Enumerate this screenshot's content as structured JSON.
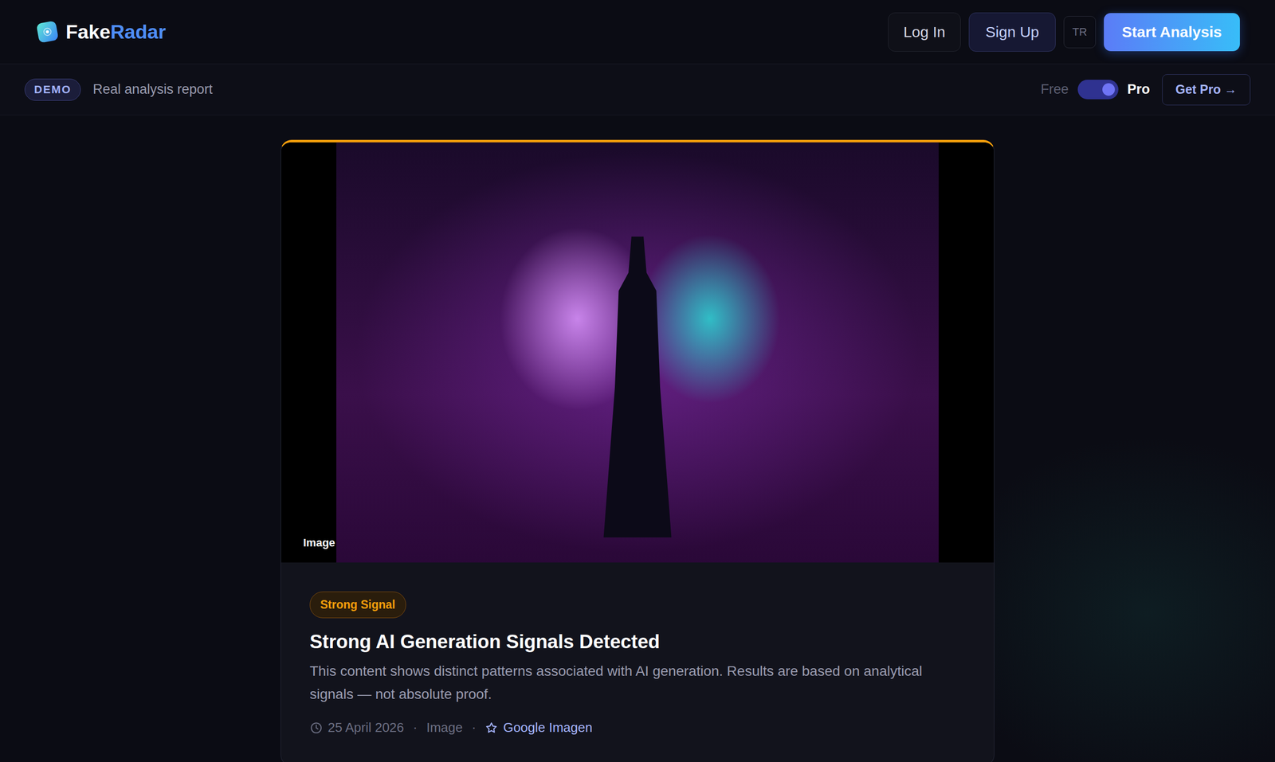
{
  "brand": {
    "name_first": "Fake",
    "name_second": "Radar"
  },
  "nav": {
    "login": "Log In",
    "signup": "Sign Up",
    "language": "TR",
    "cta": "Start Analysis"
  },
  "demo_bar": {
    "badge": "DEMO",
    "text": "Real analysis report",
    "plan_free": "Free",
    "plan_pro": "Pro",
    "pro_on": true,
    "get_pro": "Get Pro →"
  },
  "report": {
    "media_label": "Image",
    "signal": "Strong Signal",
    "title": "Strong AI Generation Signals Detected",
    "description": "This content shows distinct patterns associated with AI generation. Results are based on analytical signals — not absolute proof.",
    "meta": [
      {
        "kind": "date",
        "text": "25 April 2026"
      },
      {
        "kind": "sep",
        "text": "·"
      },
      {
        "kind": "plain",
        "text": "Image"
      },
      {
        "kind": "sep",
        "text": "·"
      },
      {
        "kind": "model",
        "text": "Google Imagen"
      }
    ]
  }
}
